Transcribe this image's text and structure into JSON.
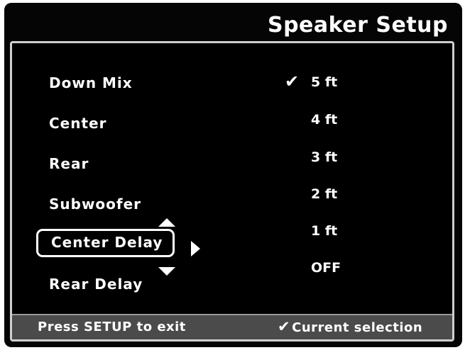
{
  "header": {
    "title": "Speaker Setup"
  },
  "menu": {
    "items": [
      {
        "label": "Down Mix"
      },
      {
        "label": "Center"
      },
      {
        "label": "Rear"
      },
      {
        "label": "Subwoofer"
      },
      {
        "label": "Center Delay"
      },
      {
        "label": "Rear Delay"
      }
    ],
    "selected_label": "Center Delay"
  },
  "options": {
    "items": [
      {
        "label": "5 ft"
      },
      {
        "label": "4 ft"
      },
      {
        "label": "3 ft"
      },
      {
        "label": "2 ft"
      },
      {
        "label": "1 ft"
      },
      {
        "label": "OFF"
      }
    ],
    "current_selection": "5 ft",
    "check_glyph": "✔"
  },
  "footer": {
    "exit_hint": "Press SETUP to exit",
    "legend_text": "Current selection"
  },
  "icons": {
    "check": "check-icon",
    "nav_up": "arrow-up-icon",
    "nav_down": "arrow-down-icon",
    "enter": "arrow-right-icon"
  },
  "colors": {
    "background": "#050505",
    "text": "#ffffff",
    "footer_bar": "#4b4b4b",
    "panel_border": "#cfcfcf"
  }
}
